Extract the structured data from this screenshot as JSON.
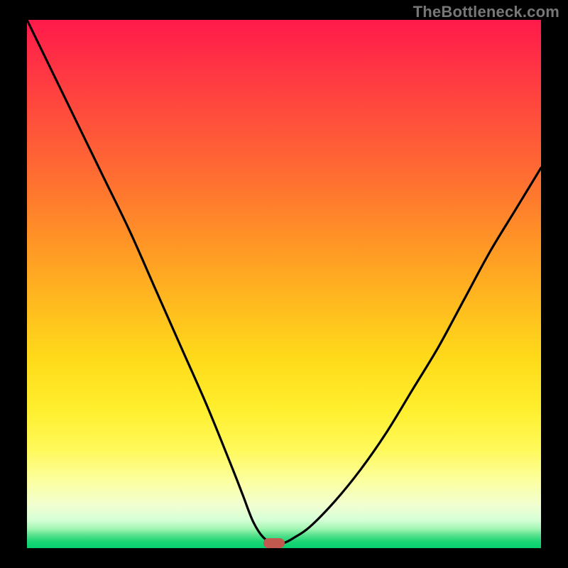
{
  "watermark": "TheBottleneck.com",
  "chart_data": {
    "type": "line",
    "title": "",
    "xlabel": "",
    "ylabel": "",
    "xlim": [
      0,
      100
    ],
    "ylim": [
      0,
      100
    ],
    "background_gradient": {
      "top": "#ff1a4b",
      "mid": "#ffe61a",
      "bottom": "#06cf6f"
    },
    "series": [
      {
        "name": "bottleneck-curve",
        "color": "#000000",
        "x": [
          0,
          5,
          10,
          15,
          20,
          25,
          30,
          35,
          40,
          42,
          44,
          46,
          48,
          50,
          52,
          55,
          60,
          65,
          70,
          75,
          80,
          85,
          90,
          95,
          100
        ],
        "y": [
          100,
          90,
          80,
          70,
          60,
          49,
          38,
          27,
          15,
          10,
          5,
          2,
          1,
          1,
          2,
          4,
          9,
          15,
          22,
          30,
          38,
          47,
          56,
          64,
          72
        ]
      }
    ],
    "marker": {
      "x": 48,
      "y": 1,
      "color": "#c1594e"
    },
    "green_band_top_y": 5
  }
}
